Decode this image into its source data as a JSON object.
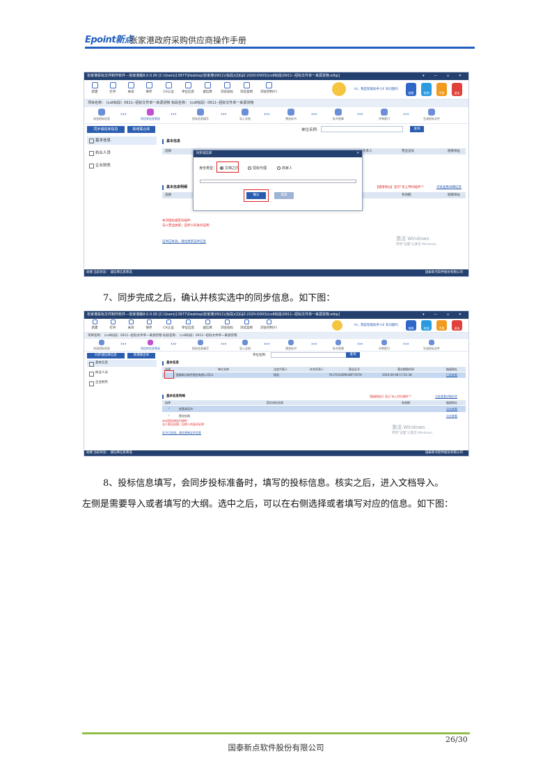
{
  "header": {
    "logo_latin": "Epoint",
    "logo_cn": "新点",
    "title": "张家港政府采购供应商操作手册"
  },
  "app": {
    "title": "张家港投标文件制作软件---张家港版8.0.0.00   [C:\\Users\\13977\\Desktop\\张家港\\0911\\(标段)(ZJGJZ-2020-D003)(cs8标段)0911--招标文件单一来源货物.etbp]",
    "toolbar": [
      "新建",
      "打开",
      "关闭",
      "保存",
      "CA认证",
      "单位信息",
      "诚信库",
      "浏览投标",
      "浏览案例",
      "浏览控制(F)"
    ],
    "greeting": "Hi，我是智能助手小E  有问题吗",
    "tiles": [
      "前版",
      "检测",
      "手册",
      "退出"
    ],
    "project_bar": "项目名称：   (cs8标段）0911--招标文件单一来源货物   标段名称：   (cs8标段）0911--招标文件单一来源货物",
    "steps": [
      "浏览招标信息",
      "同信库信息筛选",
      "投标信息填写",
      "导入文档",
      "预览标书",
      "标书签章",
      "评审索引",
      "生成投标文件"
    ],
    "sidebar_buttons": [
      "同步诚信库信息",
      "新增联合体"
    ],
    "sidebar_items": [
      "基本信息",
      "执业人员",
      "企业财务"
    ],
    "unit_label": "单位名称:",
    "query_btn": "查询",
    "section_basic": "基本信息",
    "section_detail": "基本信息明细",
    "col_select": "选择",
    "col_principal": "负责人",
    "col_license": "营业证号",
    "col_link": "链接地址",
    "col_doc_name": "提交材料名称",
    "col_valid": "有效期",
    "red_tip": "【链接地址】显示\"未上传扫描件\"？",
    "link_tip": "点此查看详细信息",
    "note_head": "本次招标规定扫描件:",
    "note_req": "法人营业执照；自然人的身份证明",
    "note_link": "证书已失效，请往更新证件信息",
    "win_title": "激活 Windows",
    "win_sub": "转到\"设置\"以激活 Windows。",
    "status_left": "就绪   当前状态：  诚信库信息筛选",
    "status_right": "国泰新点软件股份有限公司"
  },
  "modal": {
    "title": "同步诚信库",
    "identity_label": "身份类型：",
    "options": [
      "文档之内",
      "招标代理",
      "商家人"
    ],
    "confirm": "确认",
    "cancel": "取消"
  },
  "shot2": {
    "columns": [
      "选择",
      "单位名称",
      "法定代表人",
      "技术负责人",
      "营业证号",
      "营业期限时间",
      "链接地址"
    ],
    "row": [
      "",
      "国泰新点软件股份有限公司Ca",
      "杨凯",
      "",
      "91370100MA3BF7457K",
      "2020-09-08 17:51:38",
      "已选查看"
    ],
    "detail_rows": [
      [
        "✓",
        "经营承诺书",
        "点击查看"
      ],
      [
        "✓",
        "营业执照",
        "点击查看"
      ]
    ]
  },
  "para7": "7、同步完成之后，确认并核实选中的同步信息。如下图：",
  "para8a": "8、投标信息填写，会同步投标准备时，填写的投标信息。核实之后，进入文档导入。",
  "para8b": "左侧是需要导入或者填写的大纲。选中之后，可以在右侧选择或者填写对应的信息。如下图：",
  "footer": {
    "page": "26/30",
    "company": "国泰新点软件股份有限公司"
  },
  "colors": {
    "brand": "#1f5fbf",
    "accent": "#2a5db0",
    "footer_line": "#8fbf4a",
    "highlight": "#e02020"
  }
}
